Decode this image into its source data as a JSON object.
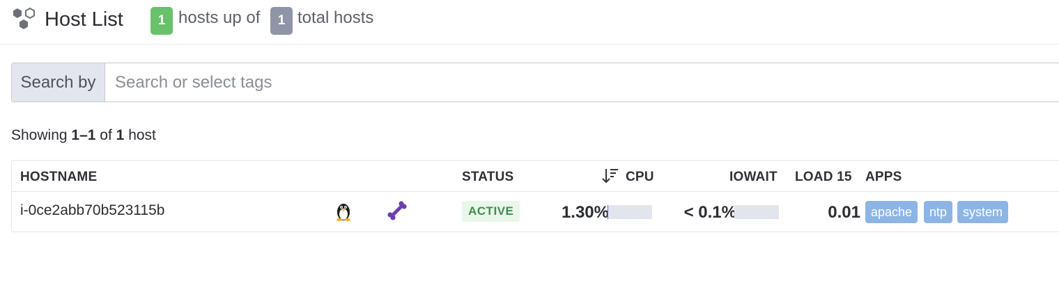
{
  "header": {
    "logo_icon": "hexagons-icon",
    "title": "Host List",
    "hosts_up": "1",
    "hosts_up_text": "hosts up of",
    "hosts_total": "1",
    "hosts_total_text": "total hosts"
  },
  "search": {
    "label": "Search by",
    "placeholder": "Search or select tags",
    "value": ""
  },
  "summary": {
    "prefix": "Showing",
    "range": "1–1",
    "of": "of",
    "count": "1",
    "unit": "host"
  },
  "table": {
    "columns": {
      "hostname": "HOSTNAME",
      "status": "STATUS",
      "cpu": "CPU",
      "iowait": "IOWAIT",
      "load15": "LOAD 15",
      "apps": "APPS"
    },
    "sort_icon": "sort-descending-icon",
    "rows": [
      {
        "hostname": "i-0ce2abb70b523115b",
        "os_icon": "linux-penguin-icon",
        "agent_icon": "bone-icon",
        "status": "ACTIVE",
        "cpu": "1.30%",
        "cpu_fraction": 0.013,
        "iowait": "< 0.1%",
        "iowait_fraction": 0.0,
        "load15": "0.01",
        "apps": [
          "apache",
          "ntp",
          "system"
        ]
      }
    ]
  },
  "colors": {
    "badge_up": "#69c16b",
    "badge_total": "#8f94a6",
    "status_active_bg": "#e9f6ea",
    "status_active_text": "#3f8f4a",
    "app_tag": "#8cb5e6",
    "bone": "#6b3fb0"
  }
}
